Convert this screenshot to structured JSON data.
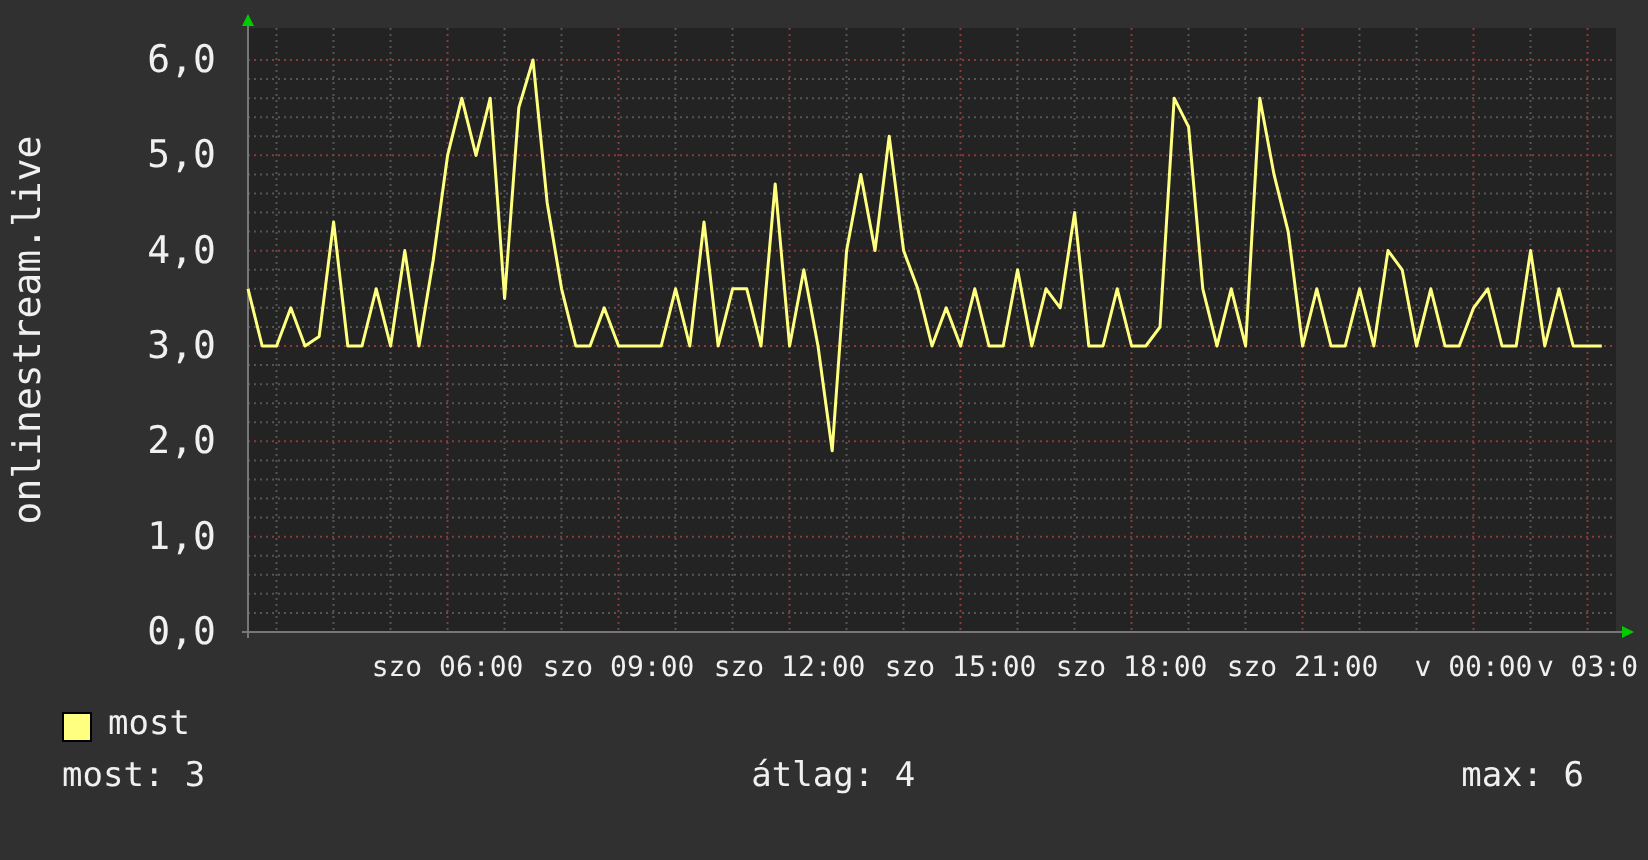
{
  "chart": {
    "chart_data": {
      "type": "line",
      "ylabel": "onlinestream.live",
      "grid": true,
      "ylim": [
        0,
        6
      ],
      "yticks": [
        {
          "value": 0,
          "label": "0,0"
        },
        {
          "value": 1,
          "label": "1,0"
        },
        {
          "value": 2,
          "label": "2,0"
        },
        {
          "value": 3,
          "label": "3,0"
        },
        {
          "value": 4,
          "label": "4,0"
        },
        {
          "value": 5,
          "label": "5,0"
        },
        {
          "value": 6,
          "label": "6,0"
        }
      ],
      "categories": [
        null,
        null,
        null,
        null,
        null,
        null,
        null,
        null,
        null,
        null,
        null,
        null,
        null,
        null,
        "szo 06:00",
        null,
        null,
        null,
        null,
        null,
        null,
        null,
        null,
        null,
        null,
        null,
        "szo 09:00",
        null,
        null,
        null,
        null,
        null,
        null,
        null,
        null,
        null,
        null,
        null,
        "szo 12:00",
        null,
        null,
        null,
        null,
        null,
        null,
        null,
        null,
        null,
        null,
        null,
        "szo 15:00",
        null,
        null,
        null,
        null,
        null,
        null,
        null,
        null,
        null,
        null,
        null,
        "szo 18:00",
        null,
        null,
        null,
        null,
        null,
        null,
        null,
        null,
        null,
        null,
        null,
        "szo 21:00",
        null,
        null,
        null,
        null,
        null,
        null,
        null,
        null,
        null,
        null,
        null,
        "v 00:00",
        null,
        null,
        null,
        null,
        null,
        null,
        null,
        "v 03:0",
        null
      ],
      "series": [
        {
          "name": "most",
          "color": "#ffff80",
          "values": [
            3.6,
            3,
            3,
            3.4,
            3,
            3.1,
            4.3,
            3,
            3,
            3.6,
            3,
            4.0,
            3.0,
            3.9,
            5.0,
            5.6,
            5.0,
            5.6,
            3.5,
            5.5,
            6.0,
            4.5,
            3.6,
            3.0,
            3,
            3.4,
            3,
            3,
            3,
            3,
            3.6,
            3,
            4.3,
            3,
            3.6,
            3.6,
            3,
            4.7,
            3,
            3.8,
            3.0,
            1.9,
            4.0,
            4.8,
            4.0,
            5.2,
            4.0,
            3.6,
            3,
            3.4,
            3,
            3.6,
            3,
            3,
            3.8,
            3,
            3.6,
            3.4,
            4.4,
            3,
            3,
            3.6,
            3,
            3,
            3.2,
            5.6,
            5.3,
            3.6,
            3,
            3.6,
            3,
            5.6,
            4.8,
            4.2,
            3,
            3.6,
            3,
            3,
            3.6,
            3,
            4.0,
            3.8,
            3,
            3.6,
            3,
            3,
            3.4,
            3.6,
            3,
            3,
            4.0,
            3,
            3.6,
            3,
            3,
            3.0
          ]
        }
      ]
    }
  },
  "stats": [
    "most: 3",
    "átlag: 4",
    "max: 6"
  ]
}
